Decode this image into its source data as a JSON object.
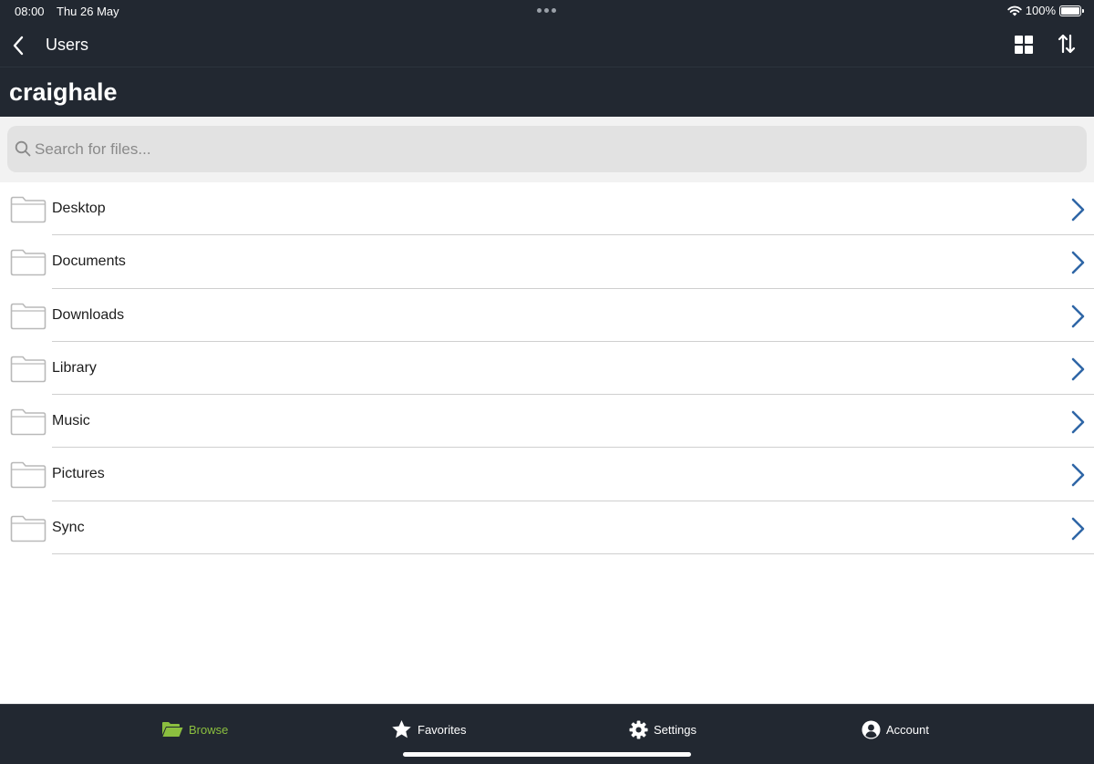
{
  "status_bar": {
    "time": "08:00",
    "date": "Thu 26 May",
    "battery_text": "100%",
    "icons": [
      "wifi-icon",
      "battery-icon",
      "multitasking-dots-icon"
    ]
  },
  "nav": {
    "back_label": "Users",
    "icons": [
      "back-chevron-icon",
      "grid-view-icon",
      "sort-icon"
    ]
  },
  "page": {
    "title": "craighale"
  },
  "search": {
    "placeholder": "Search for files...",
    "value": ""
  },
  "files": [
    {
      "name": "Desktop"
    },
    {
      "name": "Documents"
    },
    {
      "name": "Downloads"
    },
    {
      "name": "Library"
    },
    {
      "name": "Music"
    },
    {
      "name": "Pictures"
    },
    {
      "name": "Sync"
    }
  ],
  "tabs": [
    {
      "label": "Browse",
      "icon": "folder-open-icon",
      "active": true
    },
    {
      "label": "Favorites",
      "icon": "star-icon",
      "active": false
    },
    {
      "label": "Settings",
      "icon": "gear-icon",
      "active": false
    },
    {
      "label": "Account",
      "icon": "user-circle-icon",
      "active": false
    }
  ],
  "colors": {
    "header_bg": "#222831",
    "active_tab": "#8bbf3f",
    "chevron": "#2f66a6",
    "folder_outline": "#b9b9b9"
  }
}
